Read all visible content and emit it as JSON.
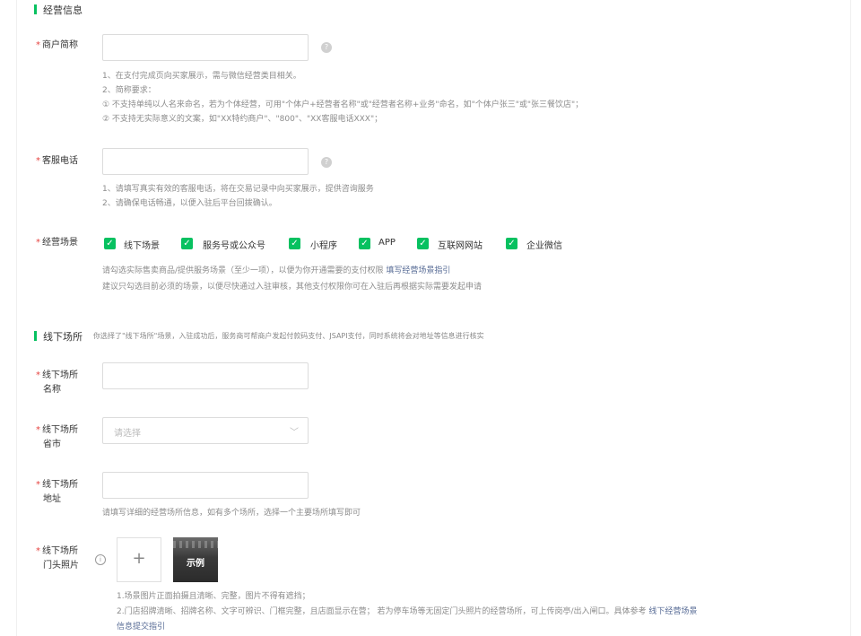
{
  "sections": {
    "business_info_title": "经营信息",
    "offline_title": "线下场所",
    "offline_note": "你选择了\"线下场所\"场景，入驻成功后，服务商可帮商户发起付款码支付、JSAPI支付，同时系统将会对地址等信息进行核实"
  },
  "merchant_short_name": {
    "required_mark": "*",
    "label": "商户简称",
    "value": "",
    "hints": [
      "1、在支付完成页向买家展示，需与微信经营类目相关。",
      "2、简称要求：",
      "① 不支持单纯以人名来命名，若为个体经营，可用\"个体户+经营者名称\"或\"经营者名称+业务\"命名，如\"个体户张三\"或\"张三餐饮店\"；",
      "② 不支持无实际意义的文案，如\"XX特约商户\"、\"800\"、\"XX客服电话XXX\"；"
    ]
  },
  "service_phone": {
    "required_mark": "*",
    "label": "客服电话",
    "value": "",
    "hints": [
      "1、请填写真实有效的客服电话，将在交易记录中向买家展示，提供咨询服务",
      "2、请确保电话畅通，以便入驻后平台回拨确认。"
    ]
  },
  "business_scenes": {
    "required_mark": "*",
    "label": "经营场景",
    "options": [
      {
        "label": "线下场景",
        "checked": true
      },
      {
        "label": "服务号或公众号",
        "checked": true
      },
      {
        "label": "小程序",
        "checked": true
      },
      {
        "label": "APP",
        "checked": true
      },
      {
        "label": "互联网网站",
        "checked": true
      },
      {
        "label": "企业微信",
        "checked": true
      }
    ],
    "hint_line1": "请勾选实际售卖商品/提供服务场景（至少一项），以便为你开通需要的支付权限",
    "hint_link": "填写经营场景指引",
    "hint_line2": "建议只勾选目前必须的场景，以便尽快通过入驻审核，其他支付权限你可在入驻后再根据实际需要发起申请"
  },
  "offline_name": {
    "required_mark": "*",
    "label_line1": "线下场所",
    "label_line2": "名称",
    "value": ""
  },
  "offline_city": {
    "required_mark": "*",
    "label_line1": "线下场所",
    "label_line2": "省市",
    "placeholder": "请选择",
    "chevron": "﹀"
  },
  "offline_address": {
    "required_mark": "*",
    "label_line1": "线下场所",
    "label_line2": "地址",
    "value": "",
    "hint": "请填写详细的经营场所信息，如有多个场所，选择一个主要场所填写即可"
  },
  "offline_photo": {
    "required_mark": "*",
    "label_line1": "线下场所",
    "label_line2": "门头照片",
    "upload_symbol": "+",
    "example_label": "示例",
    "hint_line1": "1.场景图片正面拍摄且清晰、完整，图片不得有遮挡；",
    "hint_line2": "2.门店招牌清晰、招牌名称、文字可辨识、门框完整，且店面显示在营； 若为停车场等无固定门头照片的经营场所，可上传岗亭/出入闸口。具体参考",
    "hint_link_part1": "线下经营场景",
    "hint_link_part2": "信息提交指引"
  },
  "icons": {
    "help": "?",
    "info": "i",
    "check": "✓"
  },
  "colors": {
    "brand_green": "#07c160",
    "required_red": "#e64340",
    "link_blue": "#576b95"
  }
}
